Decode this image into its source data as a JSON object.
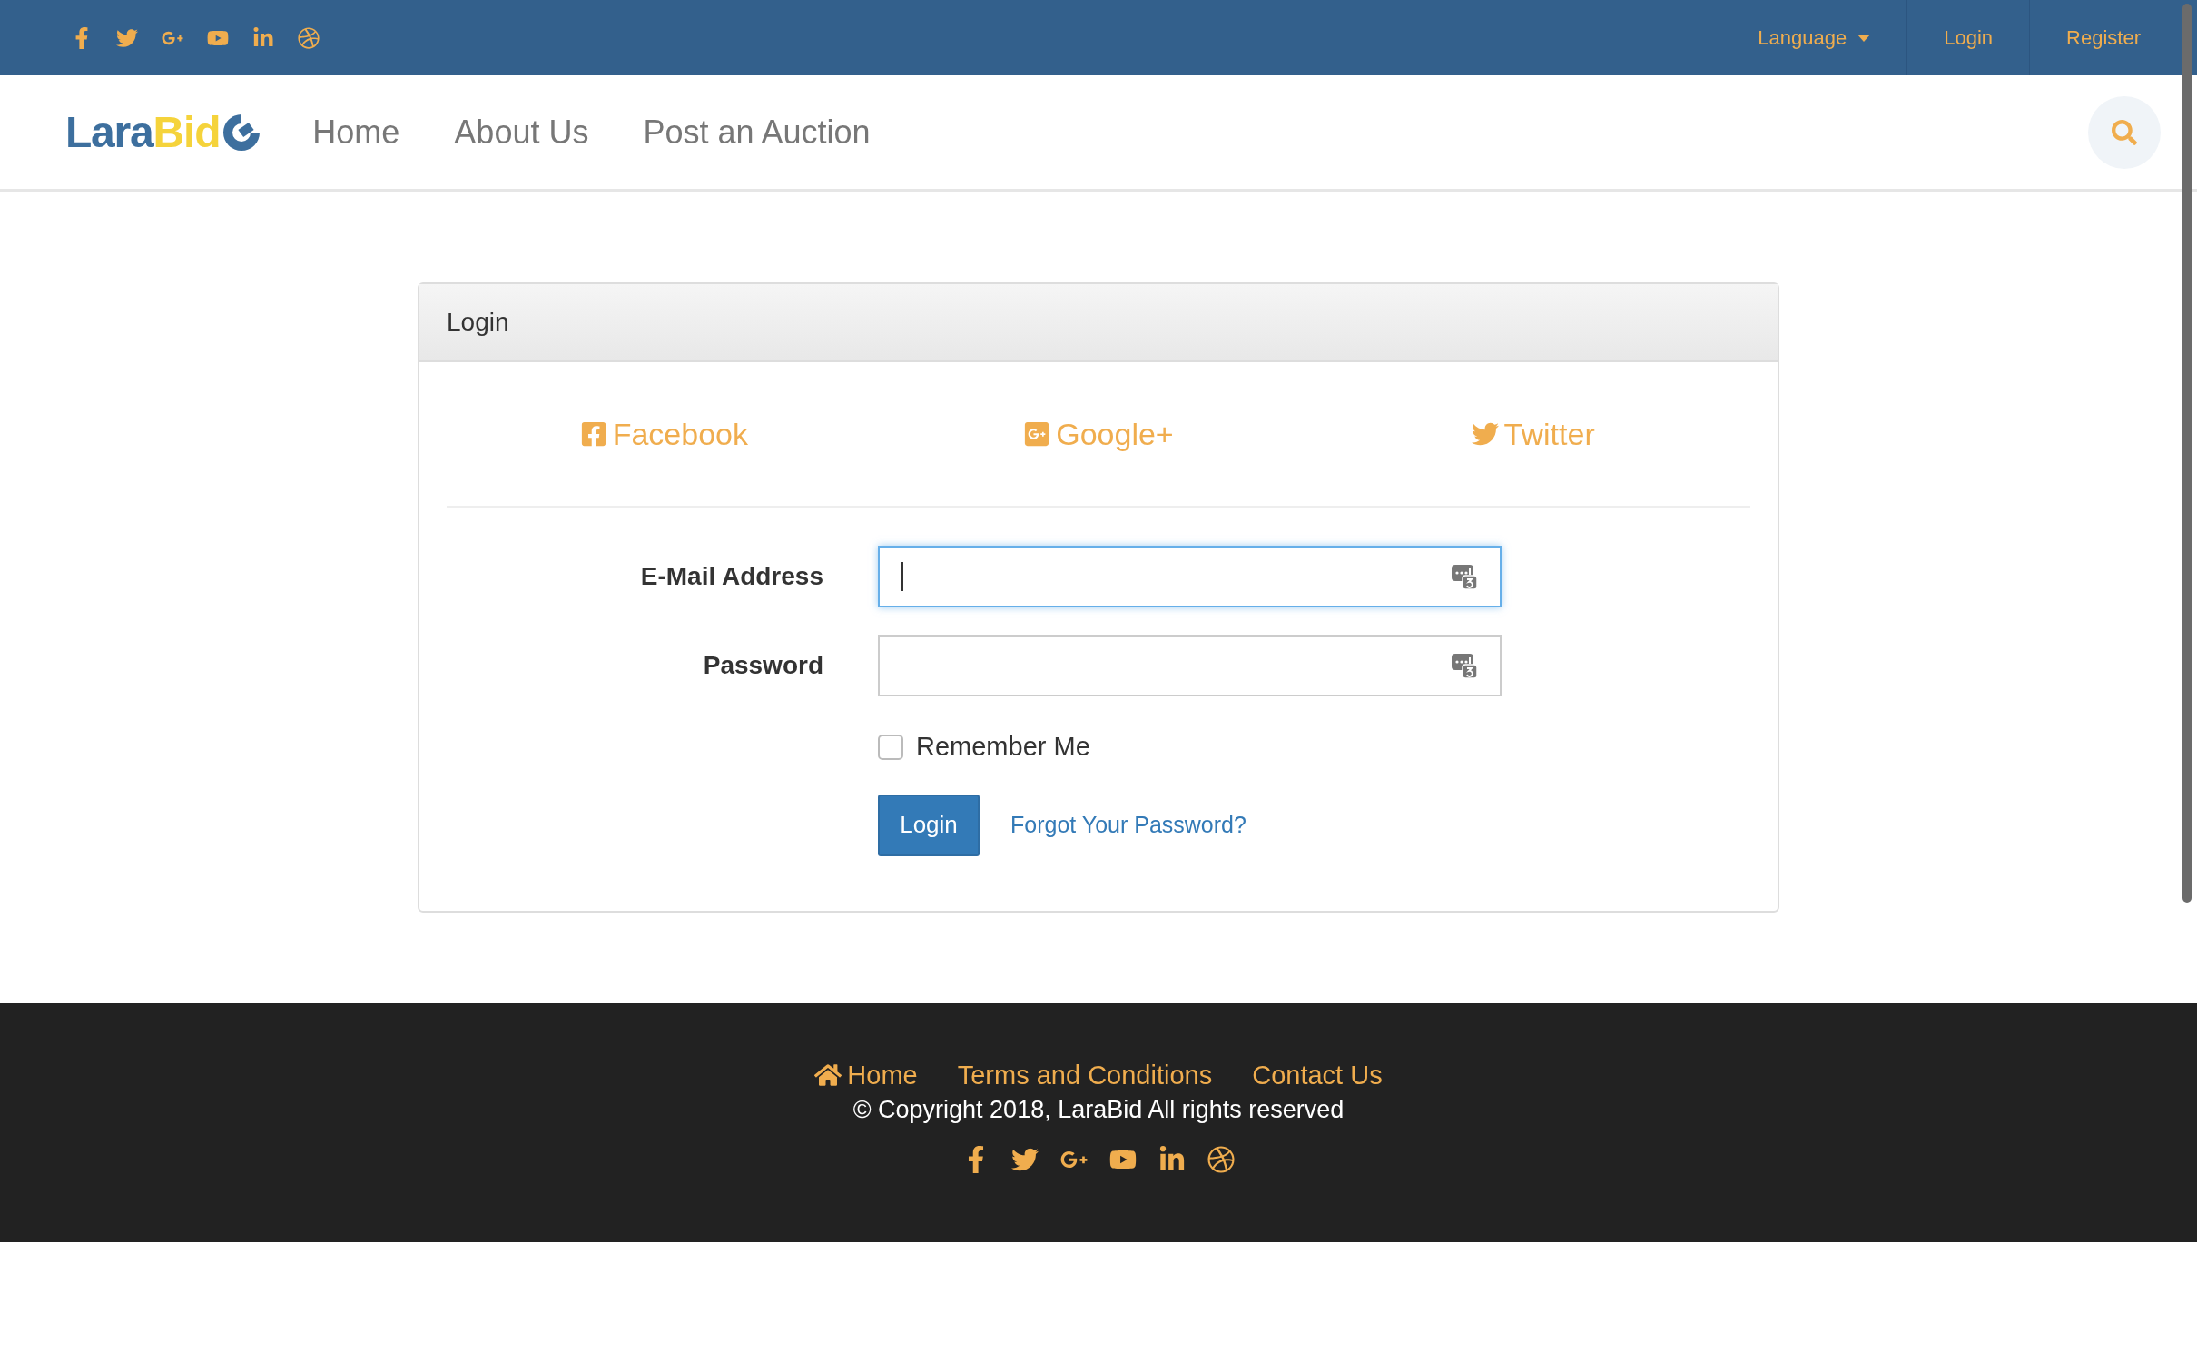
{
  "top_bar": {
    "links": [
      {
        "label": "Language",
        "kind": "dropdown"
      },
      {
        "label": "Login",
        "kind": "link"
      },
      {
        "label": "Register",
        "kind": "link"
      }
    ]
  },
  "navbar": {
    "logo": {
      "parts": [
        "Lara",
        "Bid"
      ]
    },
    "items": [
      "Home",
      "About Us",
      "Post an Auction"
    ]
  },
  "login_card": {
    "title": "Login",
    "social_logins": [
      {
        "label": "Facebook",
        "kind": "facebook"
      },
      {
        "label": "Google+",
        "kind": "google"
      },
      {
        "label": "Twitter",
        "kind": "twitter"
      }
    ],
    "fields": [
      {
        "label": "E-Mail Address",
        "focused": true
      },
      {
        "label": "Password",
        "focused": false
      }
    ],
    "remember": {
      "label": "Remember Me",
      "checked": false
    },
    "submit": "Login",
    "forgot": "Forgot Your Password?"
  },
  "footer": {
    "links": [
      {
        "label": "Home",
        "kind": "home"
      },
      {
        "label": "Terms and Conditions",
        "kind": "plain"
      },
      {
        "label": "Contact Us",
        "kind": "plain"
      }
    ],
    "copyright": "© Copyright 2018, LaraBid All rights reserved"
  }
}
